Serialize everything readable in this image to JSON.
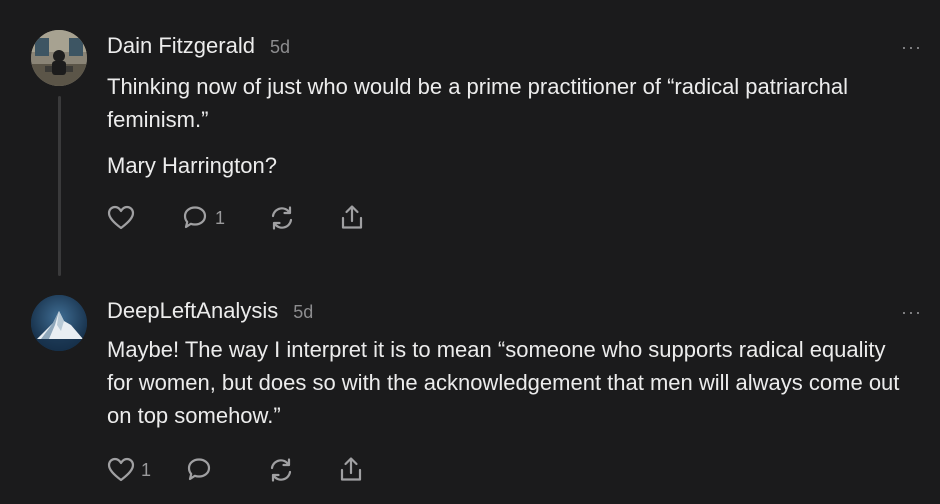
{
  "comments": [
    {
      "author": "Dain Fitzgerald",
      "time": "5d",
      "more": "···",
      "paragraphs": [
        "Thinking now of just who would be a prime practitioner of “radical patriarchal feminism.”",
        "Mary Harrington?"
      ],
      "like_count": "",
      "reply_count": "1",
      "avatar_icon": "person-at-desk-photo"
    },
    {
      "author": "DeepLeftAnalysis",
      "time": "5d",
      "more": "···",
      "paragraphs": [
        "Maybe! The way I interpret it is to mean “someone who supports radical equality for women, but does so with the acknowledgement that men will always come out on top somehow.”"
      ],
      "like_count": "1",
      "reply_count": "",
      "avatar_icon": "snowy-mountain-logo"
    }
  ],
  "icons": {
    "like": "heart-icon",
    "reply": "speech-bubble-icon",
    "restack": "restack-icon",
    "share": "share-icon"
  },
  "colors": {
    "background": "#1b1b1c",
    "text": "#ececec",
    "muted": "#8d8d8f"
  }
}
